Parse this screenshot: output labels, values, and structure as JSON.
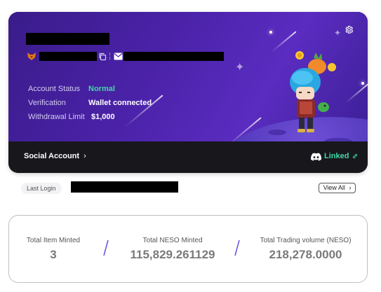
{
  "profile": {
    "account_status_label": "Account Status",
    "account_status_value": "Normal",
    "verification_label": "Verification",
    "verification_value": "Wallet connected",
    "withdrawal_limit_label": "Withdrawal Limit",
    "withdrawal_limit_value": "$1,000",
    "icons": {
      "wallet": "fox-icon",
      "copy": "copy-icon",
      "email": "mail-icon",
      "settings": "gear-icon"
    },
    "colors": {
      "hero_gradient_start": "#3a1c8a",
      "hero_gradient_end": "#5a2cc0",
      "status_green": "#3fd9a5",
      "footer_bg": "#17171c"
    }
  },
  "footer": {
    "social_account_label": "Social Account",
    "social_account_chevron": "›",
    "linked_label": "Linked",
    "linked_icon": "link-icon",
    "discord_icon": "discord-icon"
  },
  "login": {
    "last_login_label": "Last Login",
    "view_all_label": "View All",
    "view_all_chevron": "›"
  },
  "stats": {
    "items": [
      {
        "label": "Total Item Minted",
        "value": "3"
      },
      {
        "label": "Total NESO Minted",
        "value": "115,829.261129"
      },
      {
        "label": "Total Trading volume (NESO)",
        "value": "218,278.0000"
      }
    ],
    "separator_color": "#6a4fd6"
  }
}
